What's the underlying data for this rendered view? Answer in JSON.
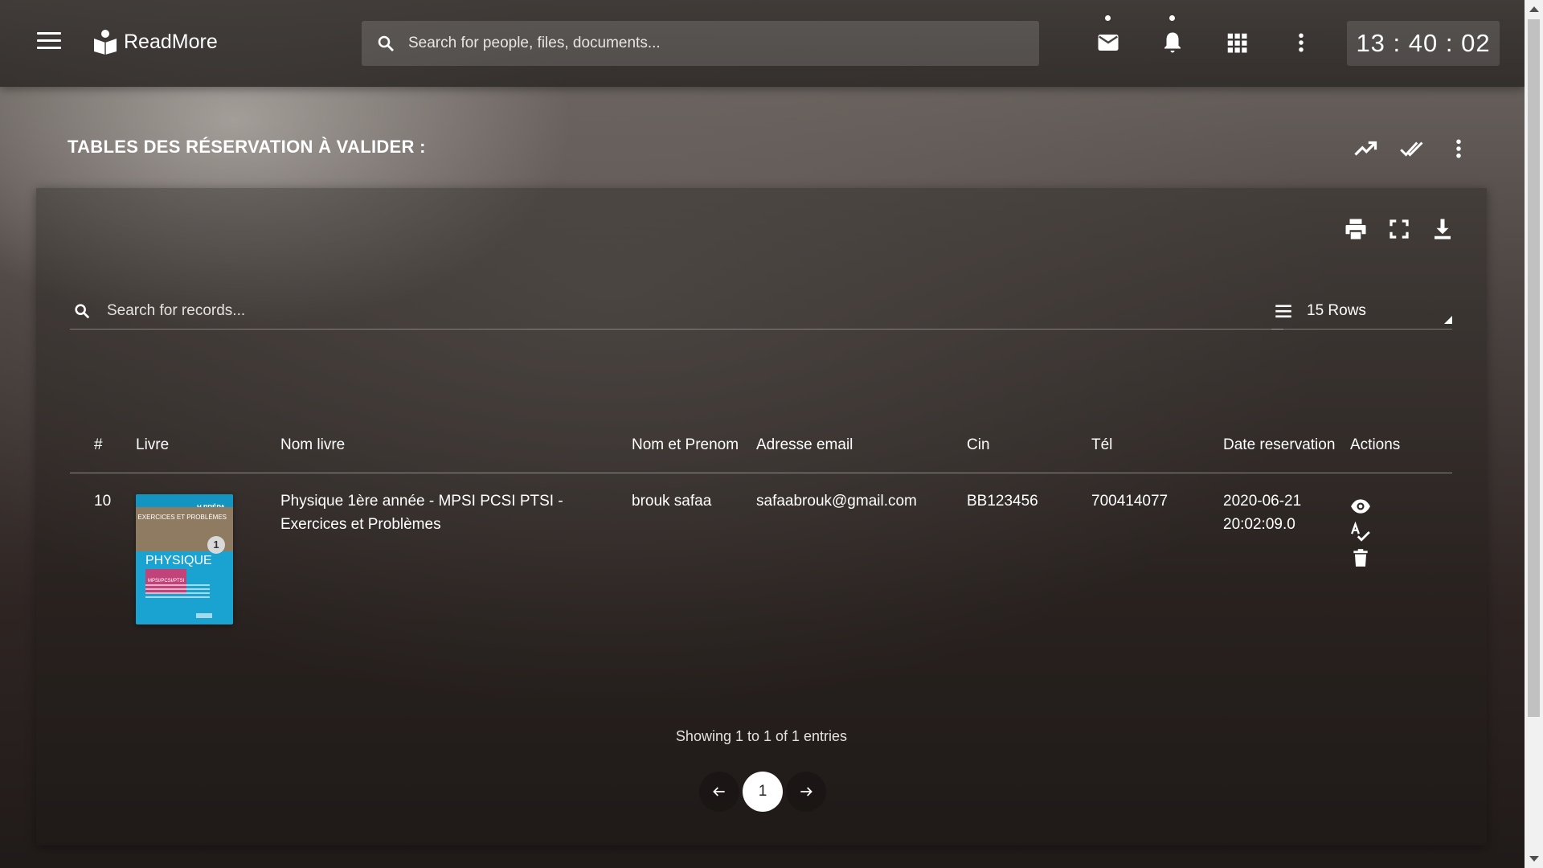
{
  "app": {
    "name": "ReadMore",
    "search_placeholder": "Search for people, files, documents...",
    "clock": "13 : 40 : 02"
  },
  "page": {
    "title": "TABLES DES RÉSERVATION À VALIDER :"
  },
  "table_tools": {
    "search_placeholder": "Search for records...",
    "rows_label": "15 Rows"
  },
  "table": {
    "headers": [
      "#",
      "Livre",
      "Nom livre",
      "Nom et Prenom",
      "Adresse email",
      "Cin",
      "Tél",
      "Date reservation",
      "Actions"
    ],
    "rows": [
      {
        "num": "10",
        "book_cover": {
          "band": "H PRÉPA",
          "photo_text": "EXERCICES ET PROBLÈMES",
          "badge": "1",
          "title": "PHYSIQUE",
          "subtitle": "MPSI/PCSI/PTSI"
        },
        "nom_livre": "Physique 1ère année - MPSI PCSI PTSI - Exercices et Problèmes",
        "nom_prenom": "brouk safaa",
        "email": "safaabrouk@gmail.com",
        "cin": "BB123456",
        "tel": "700414077",
        "date": "2020-06-21 20:02:09.0"
      }
    ]
  },
  "footer": {
    "entries_info": "Showing 1 to 1 of 1 entries",
    "current_page": "1"
  },
  "icons": {
    "header_right": [
      "mail-icon",
      "bell-icon",
      "apps-grid-icon",
      "more-vert-icon"
    ],
    "page_actions": [
      "trending-up-icon",
      "done-all-icon",
      "more-vert-icon"
    ],
    "card_tools": [
      "print-icon",
      "fullscreen-icon",
      "download-icon"
    ],
    "row_actions": [
      "eye-icon",
      "spellcheck-icon",
      "trash-icon"
    ]
  }
}
